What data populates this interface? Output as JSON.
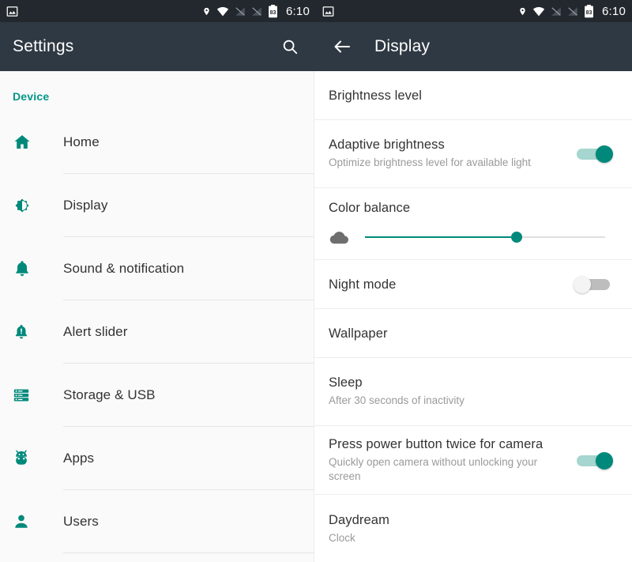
{
  "status_bar": {
    "left_icons": [
      "screenshot-image-icon"
    ],
    "right_icons": [
      "location-pin-icon",
      "wifi-icon",
      "sim-1-no-signal-icon",
      "sim-2-no-signal-icon",
      "battery-icon"
    ],
    "battery_level": "83",
    "time": "6:10"
  },
  "left_app_bar": {
    "title": "Settings",
    "search_icon": "search-icon"
  },
  "right_app_bar": {
    "back_icon": "arrow-back-icon",
    "title": "Display"
  },
  "sidebar": {
    "section_label": "Device",
    "items": [
      {
        "label": "Home",
        "icon": "home-icon"
      },
      {
        "label": "Display",
        "icon": "brightness-icon"
      },
      {
        "label": "Sound & notification",
        "icon": "bell-icon"
      },
      {
        "label": "Alert slider",
        "icon": "bell-alert-icon"
      },
      {
        "label": "Storage & USB",
        "icon": "storage-list-icon"
      },
      {
        "label": "Apps",
        "icon": "android-robot-icon"
      },
      {
        "label": "Users",
        "icon": "person-icon"
      }
    ]
  },
  "display_settings": {
    "brightness_level": {
      "title": "Brightness level"
    },
    "adaptive_brightness": {
      "title": "Adaptive brightness",
      "subtitle": "Optimize brightness level for available light",
      "toggle_state": "on"
    },
    "color_balance": {
      "title": "Color balance",
      "icon": "cloud-brightness-icon",
      "value_percent": 63
    },
    "night_mode": {
      "title": "Night mode",
      "toggle_state": "off"
    },
    "wallpaper": {
      "title": "Wallpaper"
    },
    "sleep": {
      "title": "Sleep",
      "subtitle": "After 30 seconds of inactivity"
    },
    "power_button_camera": {
      "title": "Press power button twice for camera",
      "subtitle": "Quickly open camera without unlocking your screen",
      "toggle_state": "on"
    },
    "daydream": {
      "title": "Daydream",
      "subtitle": "Clock"
    }
  },
  "colors": {
    "accent_teal": "#00897b",
    "status_bar_bg": "#23282e",
    "app_bar_bg": "#2f3943",
    "sidebar_bg": "#fafafa",
    "content_bg": "#ffffff"
  }
}
